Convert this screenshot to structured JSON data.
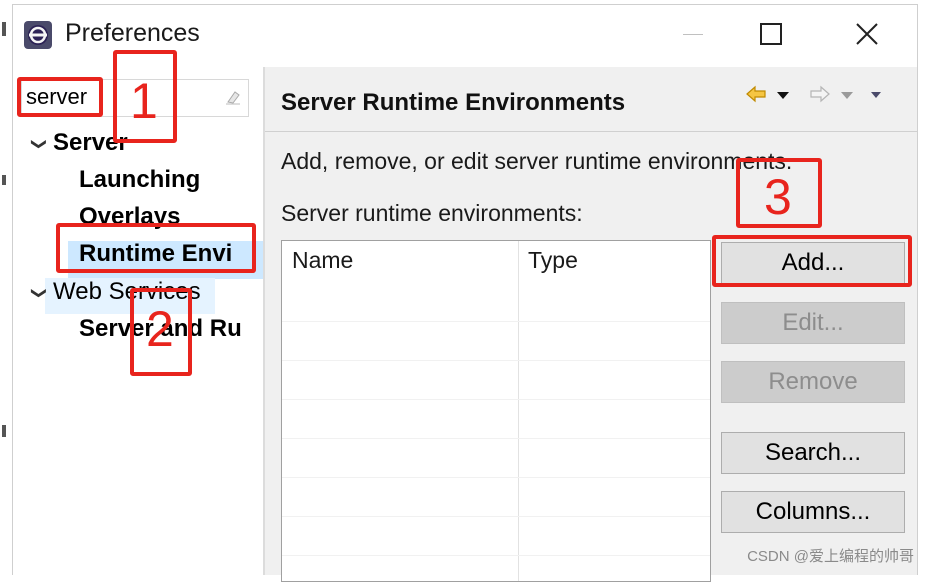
{
  "window": {
    "title": "Preferences",
    "minimize_icon": "minimize-icon",
    "maximize_icon": "maximize-icon",
    "close_icon": "close-icon"
  },
  "filter": {
    "value": "server",
    "clear_icon": "eraser-icon"
  },
  "tree": {
    "items": [
      {
        "label": "Server",
        "bold": true,
        "expanded": true
      },
      {
        "label": "Launching",
        "bold": true
      },
      {
        "label": "Overlays",
        "bold": true
      },
      {
        "label": "Runtime Envi",
        "bold": true,
        "selected": true
      },
      {
        "label": "Web Services",
        "bold": false,
        "expanded": true
      },
      {
        "label": "Server and Ru",
        "bold": true
      }
    ]
  },
  "page": {
    "title": "Server Runtime Environments",
    "description": "Add, remove, or edit server runtime environments.",
    "list_label": "Server runtime environments:",
    "table": {
      "columns": [
        "Name",
        "Type"
      ],
      "rows": []
    }
  },
  "buttons": {
    "add": "Add...",
    "edit": "Edit...",
    "remove": "Remove",
    "search": "Search...",
    "columns": "Columns..."
  },
  "annotations": {
    "step1": "1",
    "step2": "2",
    "step3": "3",
    "color": "#e8241d"
  },
  "watermark": "CSDN @爱上编程的帅哥",
  "colors": {
    "selection": "#cde8ff",
    "header_bg": "#f0f0f0",
    "nav_arrow": "#f0b000"
  }
}
